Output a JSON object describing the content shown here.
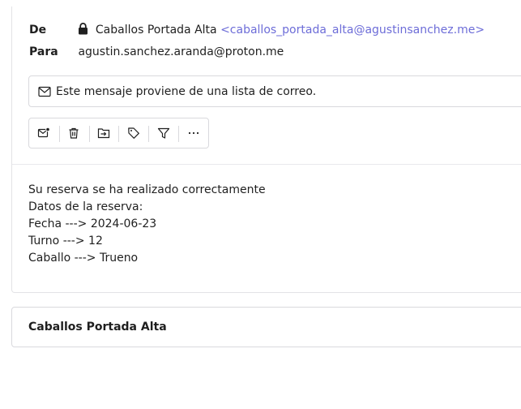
{
  "header": {
    "from_label": "De",
    "from_name": "Caballos Portada Alta",
    "from_email": "<caballos_portada_alta@agustinsanchez.me>",
    "to_label": "Para",
    "to_value": "agustin.sanchez.aranda@proton.me"
  },
  "notice": {
    "text": "Este mensaje proviene de una lista de correo."
  },
  "toolbar": {
    "buttons": [
      {
        "icon": "mark-unread-icon"
      },
      {
        "icon": "trash-icon"
      },
      {
        "icon": "move-to-folder-icon"
      },
      {
        "icon": "tag-icon"
      },
      {
        "icon": "filter-icon"
      },
      {
        "icon": "more-icon"
      }
    ]
  },
  "body": {
    "lines": [
      "Su reserva se ha realizado correctamente",
      "Datos de la reserva:",
      "Fecha ---> 2024-06-23",
      "Turno ---> 12",
      "Caballo ---> Trueno"
    ]
  },
  "footer": {
    "sender_name": "Caballos Portada Alta"
  }
}
